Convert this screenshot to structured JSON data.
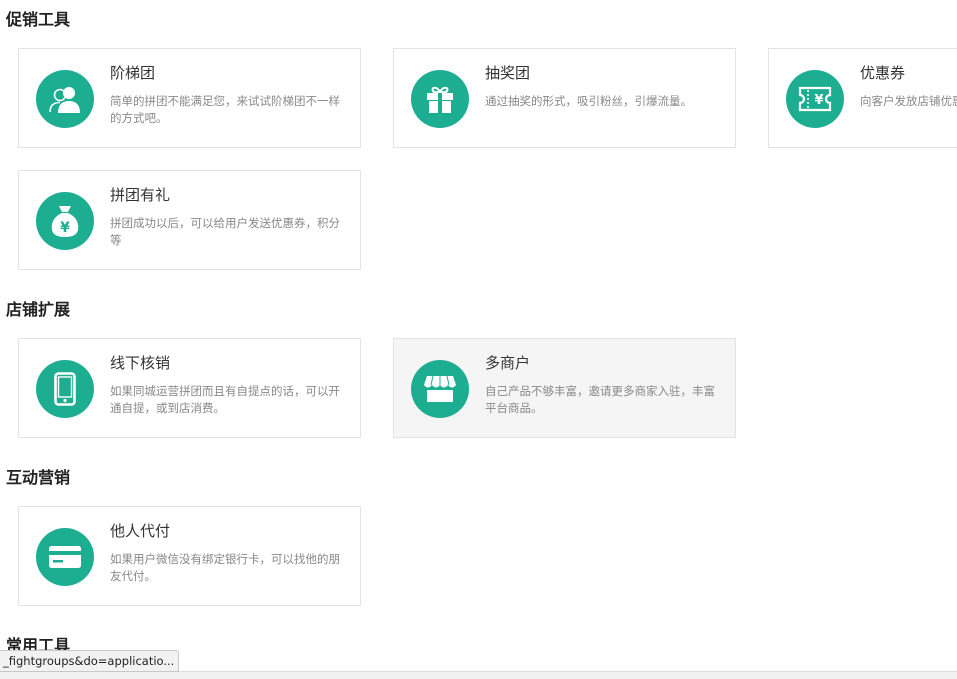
{
  "sections": {
    "promo": {
      "title": "促销工具"
    },
    "store": {
      "title": "店铺扩展"
    },
    "interactive": {
      "title": "互动营销"
    },
    "common": {
      "title": "常用工具"
    }
  },
  "cards": {
    "ladder": {
      "title": "阶梯团",
      "desc": "简单的拼团不能满足您，来试试阶梯团不一样的方式吧。",
      "icon": "users-icon"
    },
    "lottery": {
      "title": "抽奖团",
      "desc": "通过抽奖的形式，吸引粉丝，引爆流量。",
      "icon": "gift-icon"
    },
    "coupon": {
      "title": "优惠券",
      "desc": "向客户发放店铺优惠券",
      "icon": "ticket-icon"
    },
    "gift": {
      "title": "拼团有礼",
      "desc": "拼团成功以后，可以给用户发送优惠券，积分等",
      "icon": "money-bag-icon"
    },
    "offline": {
      "title": "线下核销",
      "desc": "如果同城运营拼团而且有自提点的话，可以开通自提，或到店消费。",
      "icon": "phone-icon"
    },
    "multistore": {
      "title": "多商户",
      "desc": "自己产品不够丰富，邀请更多商家入驻，丰富平台商品。",
      "icon": "shop-icon"
    },
    "payforme": {
      "title": "他人代付",
      "desc": "如果用户微信没有绑定银行卡，可以找他的朋友代付。",
      "icon": "card-icon"
    }
  },
  "status_bar": {
    "url_text": "_fightgroups&do=applicatio..."
  },
  "colors": {
    "accent": "#1dae91",
    "card_border": "#e3e3e3",
    "hover_bg": "#f5f5f5",
    "desc_text": "#888888"
  }
}
